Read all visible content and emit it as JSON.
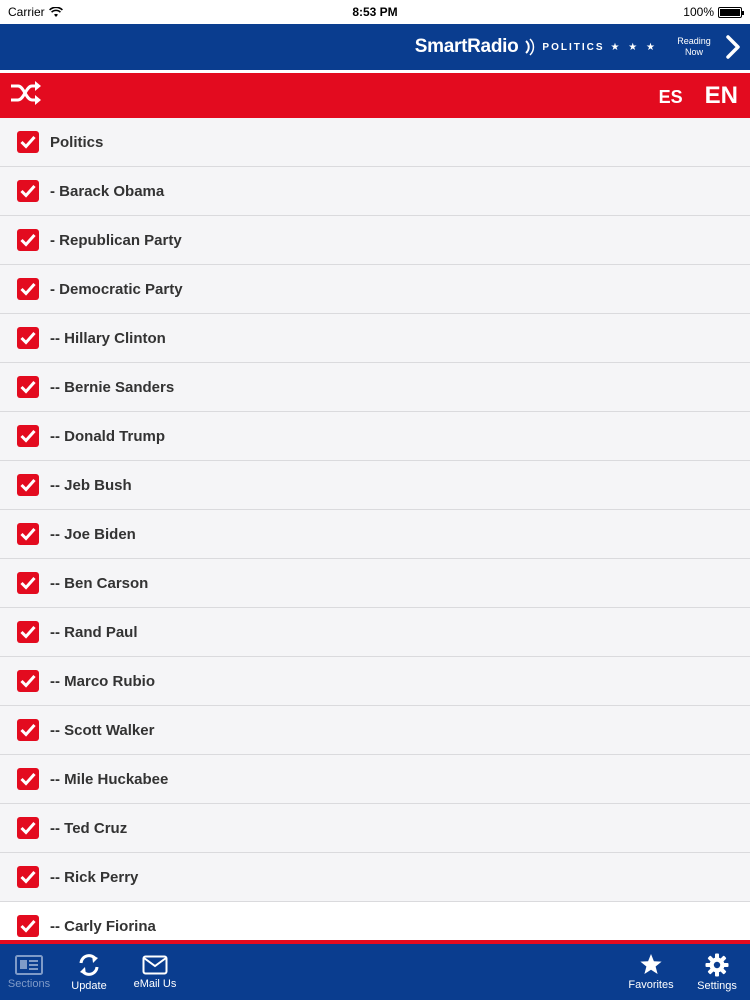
{
  "status": {
    "carrier": "Carrier",
    "time": "8:53 PM",
    "battery": "100%"
  },
  "header": {
    "brand_name": "SmartRadio",
    "brand_sub": "POLITICS",
    "brand_stars": "★ ★ ★",
    "reading_now_line1": "Reading",
    "reading_now_line2": "Now"
  },
  "toolbar": {
    "lang_es": "ES",
    "lang_en": "EN"
  },
  "list": {
    "items": [
      {
        "label": "Politics",
        "checked": true
      },
      {
        "label": "- Barack Obama",
        "checked": true
      },
      {
        "label": "- Republican Party",
        "checked": true
      },
      {
        "label": "- Democratic Party",
        "checked": true
      },
      {
        "label": "-- Hillary Clinton",
        "checked": true
      },
      {
        "label": "-- Bernie Sanders",
        "checked": true
      },
      {
        "label": "-- Donald Trump",
        "checked": true
      },
      {
        "label": "-- Jeb Bush",
        "checked": true
      },
      {
        "label": "-- Joe Biden",
        "checked": true
      },
      {
        "label": "-- Ben Carson",
        "checked": true
      },
      {
        "label": "-- Rand Paul",
        "checked": true
      },
      {
        "label": "-- Marco Rubio",
        "checked": true
      },
      {
        "label": "-- Scott Walker",
        "checked": true
      },
      {
        "label": "-- Mile Huckabee",
        "checked": true
      },
      {
        "label": "-- Ted Cruz",
        "checked": true
      },
      {
        "label": "-- Rick Perry",
        "checked": true
      },
      {
        "label": "-- Carly Fiorina",
        "checked": true
      }
    ]
  },
  "tabs": {
    "sections": "Sections",
    "update": "Update",
    "email": "eMail Us",
    "favorites": "Favorites",
    "settings": "Settings"
  },
  "colors": {
    "brand_blue": "#0a3d8f",
    "brand_red": "#e30b1f",
    "list_bg": "#f5f5f7"
  }
}
